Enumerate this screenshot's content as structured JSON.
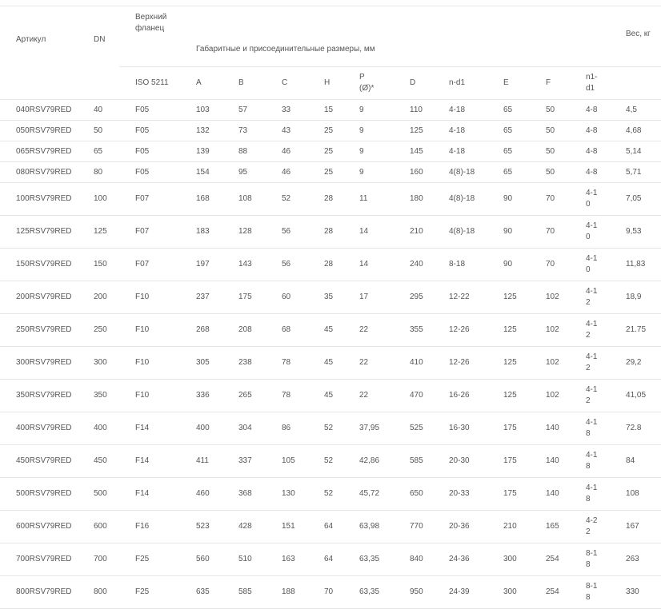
{
  "table": {
    "header": {
      "article": "Артикул",
      "dn": "DN",
      "top_flange": "Верхний фланец",
      "dimensions": "Габаритные и присоединительные размеры, мм",
      "weight": "Вес, кг",
      "iso": "ISO 5211",
      "cols": [
        "A",
        "B",
        "C",
        "H",
        "P (Ø)*",
        "D",
        "n-d1",
        "E",
        "F",
        "n1-d1"
      ]
    },
    "rows": [
      [
        "040RSV79RED",
        "40",
        "F05",
        "103",
        "57",
        "33",
        "15",
        "9",
        "110",
        "4-18",
        "65",
        "50",
        "4-8",
        "4,5"
      ],
      [
        "050RSV79RED",
        "50",
        "F05",
        "132",
        "73",
        "43",
        "25",
        "9",
        "125",
        "4-18",
        "65",
        "50",
        "4-8",
        "4,68"
      ],
      [
        "065RSV79RED",
        "65",
        "F05",
        "139",
        "88",
        "46",
        "25",
        "9",
        "145",
        "4-18",
        "65",
        "50",
        "4-8",
        "5,14"
      ],
      [
        "080RSV79RED",
        "80",
        "F05",
        "154",
        "95",
        "46",
        "25",
        "9",
        "160",
        "4(8)-18",
        "65",
        "50",
        "4-8",
        "5,71"
      ],
      [
        "100RSV79RED",
        "100",
        "F07",
        "168",
        "108",
        "52",
        "28",
        "11",
        "180",
        "4(8)-18",
        "90",
        "70",
        "4-10",
        "7,05"
      ],
      [
        "125RSV79RED",
        "125",
        "F07",
        "183",
        "128",
        "56",
        "28",
        "14",
        "210",
        "4(8)-18",
        "90",
        "70",
        "4-10",
        "9,53"
      ],
      [
        "150RSV79RED",
        "150",
        "F07",
        "197",
        "143",
        "56",
        "28",
        "14",
        "240",
        "8-18",
        "90",
        "70",
        "4-10",
        "11,83"
      ],
      [
        "200RSV79RED",
        "200",
        "F10",
        "237",
        "175",
        "60",
        "35",
        "17",
        "295",
        "12-22",
        "125",
        "102",
        "4-12",
        "18,9"
      ],
      [
        "250RSV79RED",
        "250",
        "F10",
        "268",
        "208",
        "68",
        "45",
        "22",
        "355",
        "12-26",
        "125",
        "102",
        "4-12",
        "21.75"
      ],
      [
        "300RSV79RED",
        "300",
        "F10",
        "305",
        "238",
        "78",
        "45",
        "22",
        "410",
        "12-26",
        "125",
        "102",
        "4-12",
        "29,2"
      ],
      [
        "350RSV79RED",
        "350",
        "F10",
        "336",
        "265",
        "78",
        "45",
        "22",
        "470",
        "16-26",
        "125",
        "102",
        "4-12",
        "41,05"
      ],
      [
        "400RSV79RED",
        "400",
        "F14",
        "400",
        "304",
        "86",
        "52",
        "37,95",
        "525",
        "16-30",
        "175",
        "140",
        "4-18",
        "72.8"
      ],
      [
        "450RSV79RED",
        "450",
        "F14",
        "411",
        "337",
        "105",
        "52",
        "42,86",
        "585",
        "20-30",
        "175",
        "140",
        "4-18",
        "84"
      ],
      [
        "500RSV79RED",
        "500",
        "F14",
        "460",
        "368",
        "130",
        "52",
        "45,72",
        "650",
        "20-33",
        "175",
        "140",
        "4-18",
        "108"
      ],
      [
        "600RSV79RED",
        "600",
        "F16",
        "523",
        "428",
        "151",
        "64",
        "63,98",
        "770",
        "20-36",
        "210",
        "165",
        "4-22",
        "167"
      ],
      [
        "700RSV79RED",
        "700",
        "F25",
        "560",
        "510",
        "163",
        "64",
        "63,35",
        "840",
        "24-36",
        "300",
        "254",
        "8-18",
        "263"
      ],
      [
        "800RSV79RED",
        "800",
        "F25",
        "635",
        "585",
        "188",
        "70",
        "63,35",
        "950",
        "24-39",
        "300",
        "254",
        "8-18",
        "330"
      ]
    ]
  }
}
